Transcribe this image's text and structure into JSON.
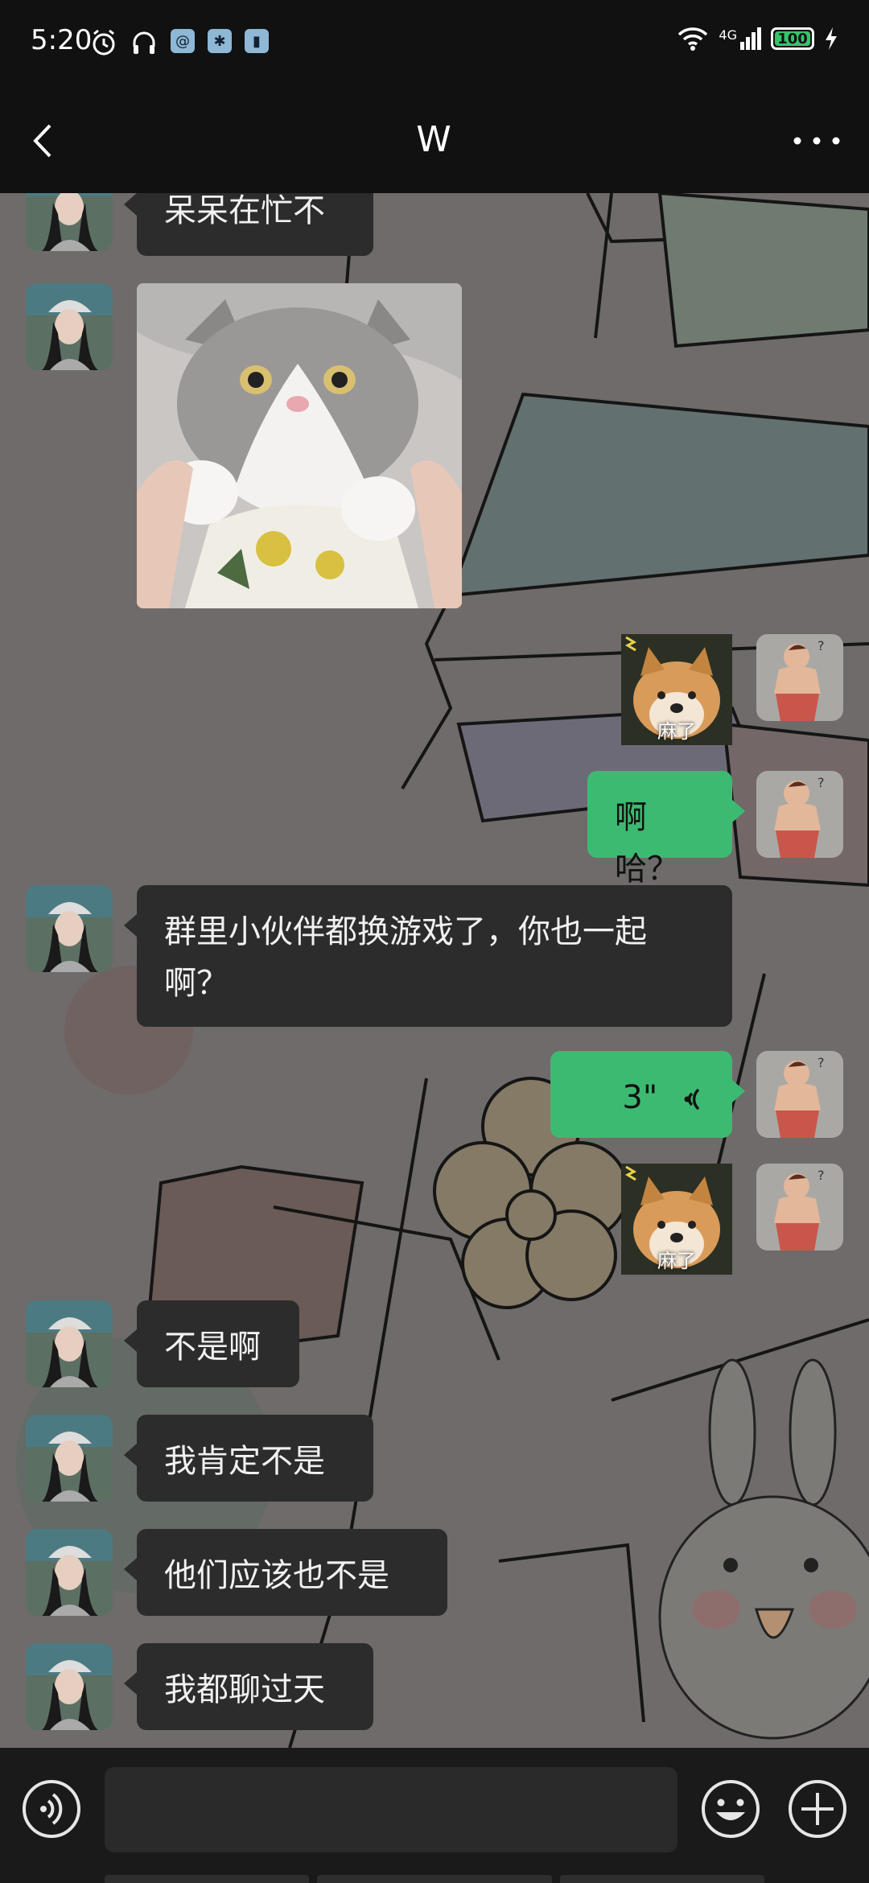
{
  "status_bar": {
    "time": "5:20",
    "network": "4G",
    "battery": "100",
    "battery_level": 1.0,
    "left_icons": [
      "alarm-icon",
      "headphones-icon",
      "app-notification-icon",
      "app-notification-icon",
      "app-notification-icon"
    ],
    "right_icons": [
      "wifi-icon",
      "cell-signal-icon",
      "battery-icon",
      "charging-icon"
    ]
  },
  "header": {
    "title": "W",
    "back_icon": "chevron-left-icon",
    "more_icon": "more-dots-icon"
  },
  "messages": [
    {
      "direction": "in",
      "type": "text",
      "text": "呆呆在忙不"
    },
    {
      "direction": "in",
      "type": "image",
      "image": "cat-photo"
    },
    {
      "direction": "out",
      "type": "sticker",
      "image": "shiba-sticker",
      "caption": "麻了"
    },
    {
      "direction": "out",
      "type": "text",
      "text": "啊哈？"
    },
    {
      "direction": "in",
      "type": "text",
      "text": "群里小伙伴都换游戏了，你也一起啊？"
    },
    {
      "direction": "out",
      "type": "voice",
      "duration": "3\""
    },
    {
      "direction": "out",
      "type": "sticker",
      "image": "shiba-sticker",
      "caption": "麻了"
    },
    {
      "direction": "in",
      "type": "text",
      "text": "不是啊"
    },
    {
      "direction": "in",
      "type": "text",
      "text": "我肯定不是"
    },
    {
      "direction": "in",
      "type": "text",
      "text": "他们应该也不是"
    },
    {
      "direction": "in",
      "type": "text",
      "text": "我都聊过天"
    }
  ],
  "input_bar": {
    "voice_icon": "voice-mode-icon",
    "placeholder": "",
    "emoji_icon": "emoji-icon",
    "plus_icon": "plus-icon"
  },
  "colors": {
    "outgoing_bubble": "#3dba72",
    "incoming_bubble": "#2c2c2c",
    "chat_background": "#6f6b6a",
    "bars": "#111111"
  }
}
